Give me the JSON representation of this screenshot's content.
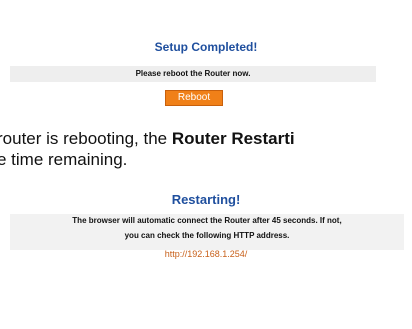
{
  "setup": {
    "title": "Setup Completed!",
    "message": "Please reboot the Router now.",
    "reboot_label": "Reboot"
  },
  "description": {
    "line1_prefix": "router is rebooting, the ",
    "line1_bold": "Router Restarti",
    "line2": "e time remaining."
  },
  "restart": {
    "title": "Restarting!",
    "line1": "The browser will automatic connect the Router after 45 seconds.  If not,",
    "line2": "you can check the following HTTP address.",
    "link": "http://192.168.1.254/"
  },
  "colors": {
    "title": "#1f4f9e",
    "button": "#f08018",
    "link": "#c8601a"
  }
}
